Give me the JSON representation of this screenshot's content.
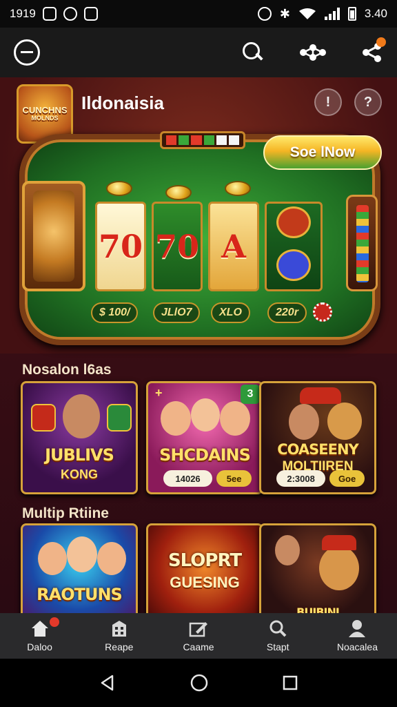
{
  "status_bar": {
    "time": "1919",
    "battery": "3.40"
  },
  "app_bar": {
    "menu_icon": "minus-circle-icon",
    "search_icon": "search-icon",
    "network_icon": "network-icon",
    "share_icon": "share-icon"
  },
  "hero": {
    "logo_line1": "CUNCHNS",
    "logo_line2": "MOLNDS",
    "title": "Ildonaisia",
    "cta_label": "Soe lNow",
    "reels": [
      "70",
      "70",
      "A"
    ],
    "payouts": [
      "$ 100/",
      "JLlO7",
      "XLO",
      "220r"
    ]
  },
  "sections": [
    {
      "title": "Nosalon l6as",
      "cards": [
        {
          "title": "JUBLIVS",
          "subtitle": "KONG"
        },
        {
          "title": "SHCDAINS",
          "count": "14026",
          "pill": "5ee",
          "badge": "3",
          "corner": "+"
        },
        {
          "title": "COASEENY",
          "subtitle": "MOLTIIREN",
          "count": "2:3008",
          "pill": "Goe"
        }
      ]
    },
    {
      "title": "Multip Rtiine",
      "cards": [
        {
          "title": "RAOTUNS"
        },
        {
          "title": "SLOPRT",
          "subtitle": "GUESING"
        },
        {
          "title": "BUIBINI"
        }
      ]
    }
  ],
  "bottom_nav": [
    {
      "label": "Daloo",
      "icon": "home-icon"
    },
    {
      "label": "Reape",
      "icon": "building-icon"
    },
    {
      "label": "Caame",
      "icon": "cards-icon"
    },
    {
      "label": "Stapt",
      "icon": "search-icon"
    },
    {
      "label": "Noacalea",
      "icon": "profile-icon"
    }
  ],
  "colors": {
    "accent": "#f5b524",
    "nav_badge": "#e3392a",
    "cta_green": "#4aa12f"
  }
}
